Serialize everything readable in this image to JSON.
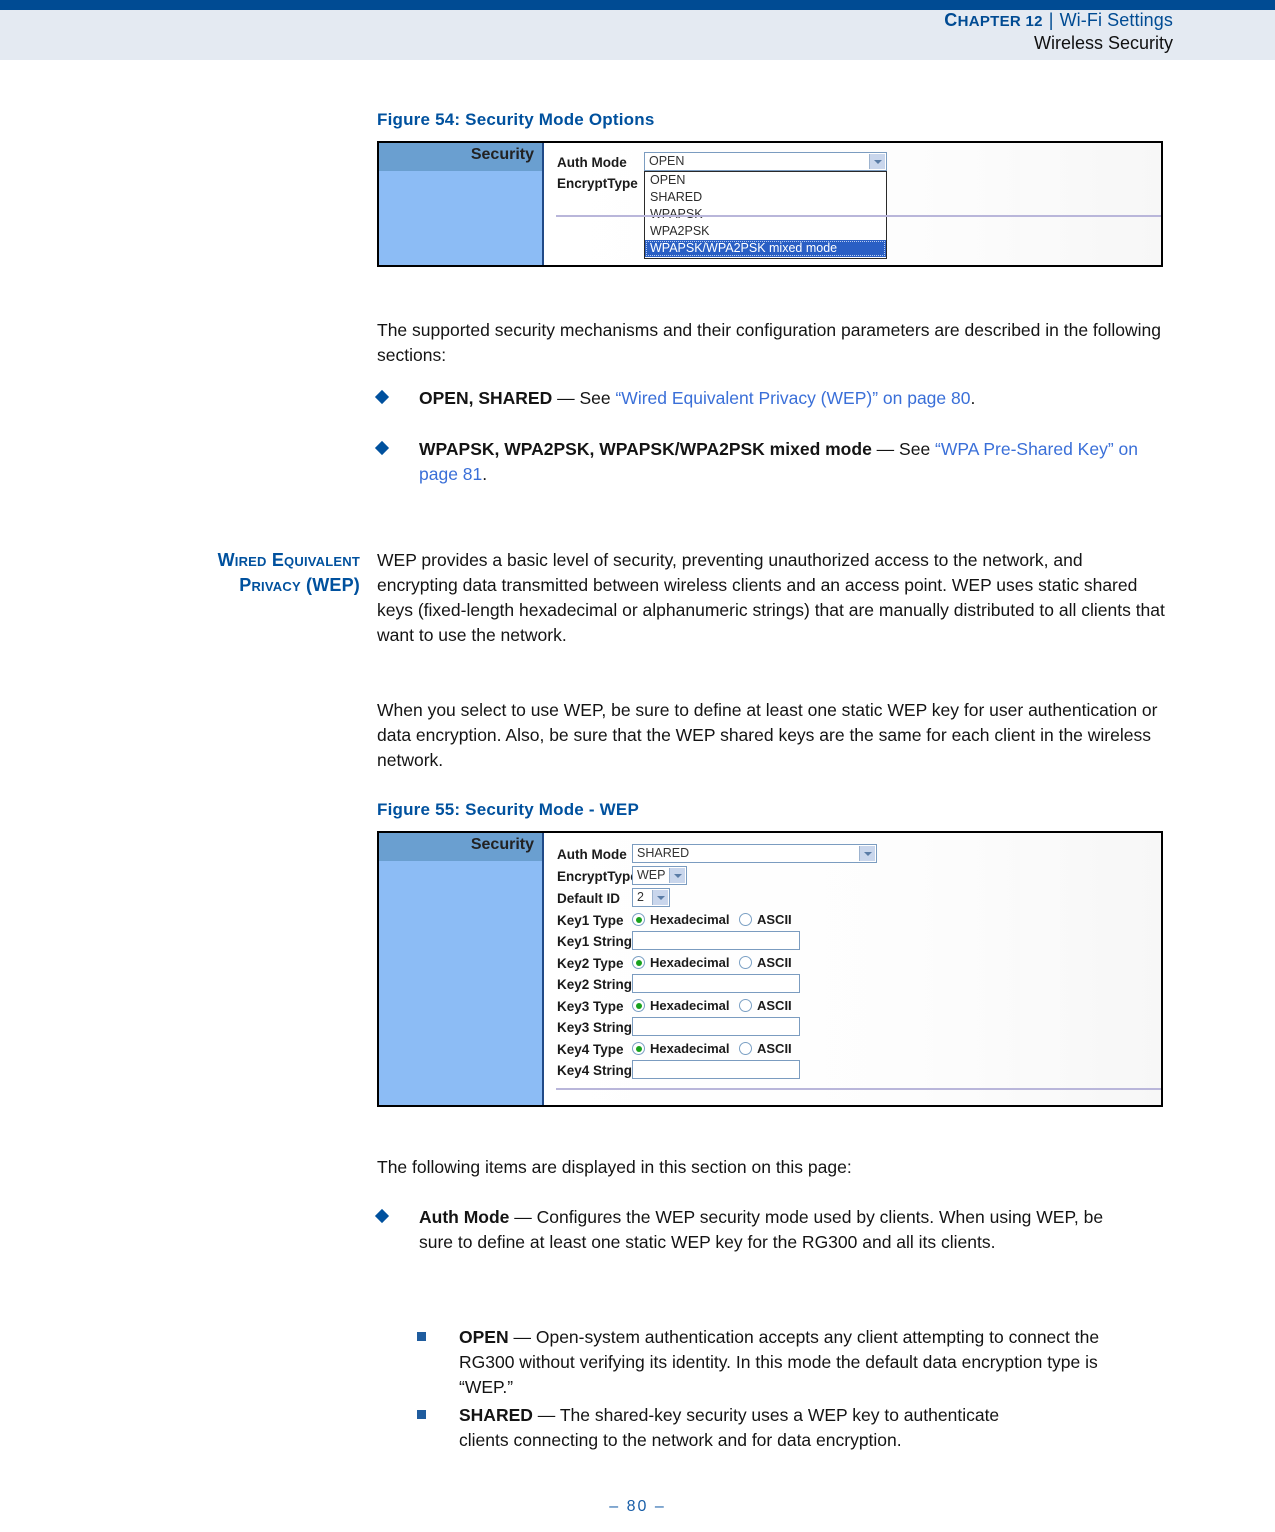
{
  "header": {
    "chapter": "Chapter 12",
    "chapter_small_caps_rest": "HAPTER 12",
    "chapter_lead": "C",
    "separator": "|",
    "section": "Wi-Fi Settings",
    "subsection": "Wireless Security"
  },
  "figure54": {
    "caption": "Figure 54:  Security Mode Options",
    "panel_title": "Security",
    "fields": [
      {
        "label": "Auth Mode",
        "value": "OPEN",
        "type": "select"
      },
      {
        "label": "EncryptType",
        "value": "",
        "type": "select"
      }
    ],
    "dropdown_open": true,
    "dropdown_options": [
      "OPEN",
      "SHARED",
      "WPAPSK",
      "WPA2PSK",
      "WPAPSK/WPA2PSK mixed mode"
    ],
    "dropdown_selected": "WPAPSK/WPA2PSK mixed mode"
  },
  "intro": {
    "paragraph": "The supported security mechanisms and their configuration parameters are described in the following sections:",
    "bullets": [
      {
        "marker": "diamond",
        "bold": "OPEN, SHARED",
        "dash": "—",
        "text_before_link": " See ",
        "link": "“Wired Equivalent Privacy (WEP)” on page 80",
        "text_after_link": "."
      },
      {
        "marker": "diamond",
        "bold": "WPAPSK, WPA2PSK, WPAPSK/WPA2PSK mixed mode",
        "dash": "—",
        "text_before_link": " See ",
        "link": "“WPA Pre-Shared Key” on page 81",
        "text_after_link": "."
      }
    ]
  },
  "wep_section": {
    "side_heading_line1": "Wired Equivalent",
    "side_heading_line2": "Privacy (WEP)",
    "paragraph1": "WEP provides a basic level of security, preventing unauthorized access to the network, and encrypting data transmitted between wireless clients and an access point. WEP uses static shared keys (fixed-length hexadecimal or alphanumeric strings) that are manually distributed to all clients that want to use the network.",
    "paragraph2": "When you select to use WEP, be sure to define at least one static WEP key for user authentication or data encryption. Also, be sure that the WEP shared keys are the same for each client in the wireless network."
  },
  "figure55": {
    "caption": "Figure 55:  Security Mode - WEP",
    "panel_title": "Security",
    "rows": [
      {
        "label": "Auth Mode",
        "kind": "select-wide",
        "value": "SHARED"
      },
      {
        "label": "EncryptType",
        "kind": "select-small",
        "value": "WEP"
      },
      {
        "label": "Default ID",
        "kind": "select-tiny",
        "value": "2"
      },
      {
        "label": "Key1 Type",
        "kind": "radio",
        "options": [
          "Hexadecimal",
          "ASCII"
        ],
        "selected": "Hexadecimal"
      },
      {
        "label": "Key1 String",
        "kind": "text",
        "value": ""
      },
      {
        "label": "Key2 Type",
        "kind": "radio",
        "options": [
          "Hexadecimal",
          "ASCII"
        ],
        "selected": "Hexadecimal"
      },
      {
        "label": "Key2 String",
        "kind": "text",
        "value": ""
      },
      {
        "label": "Key3 Type",
        "kind": "radio",
        "options": [
          "Hexadecimal",
          "ASCII"
        ],
        "selected": "Hexadecimal"
      },
      {
        "label": "Key3 String",
        "kind": "text",
        "value": ""
      },
      {
        "label": "Key4 Type",
        "kind": "radio",
        "options": [
          "Hexadecimal",
          "ASCII"
        ],
        "selected": "Hexadecimal"
      },
      {
        "label": "Key4 String",
        "kind": "text",
        "value": ""
      }
    ]
  },
  "items_section": {
    "lead": "The following items are displayed in this section on this page:",
    "bullets": [
      {
        "marker": "diamond",
        "bold": "Auth Mode",
        "dash": "—",
        "text": " Configures the WEP security mode used by clients. When using WEP, be sure to define at least one static WEP key for the RG300 and all its clients."
      },
      {
        "marker": "square",
        "bold": "OPEN",
        "dash": "—",
        "text": " Open-system authentication accepts any client attempting to connect the RG300 without verifying its identity. In this mode the default data encryption type is “WEP.”"
      },
      {
        "marker": "square",
        "bold": "SHARED",
        "dash": "—",
        "text": " The shared-key security uses a WEP key to authenticate clients connecting to the network and for data encryption."
      }
    ]
  },
  "footer": {
    "page_number": "–  80  –"
  },
  "colors": {
    "header_rule": "#004b93",
    "header_band": "#e4eaf2",
    "heading_blue": "#00519e",
    "link_blue": "#3a6fd8",
    "panel_header": "#6a9fd0",
    "panel_body": "#8cbcf5",
    "radio_on": "#19a21e",
    "list_selection": "#2a5fc4"
  }
}
